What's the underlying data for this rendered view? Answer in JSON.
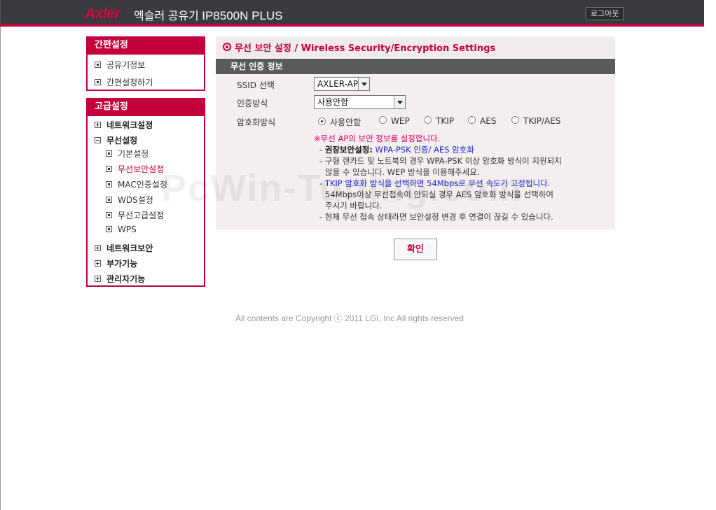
{
  "header": {
    "logo": "Axler",
    "title_ko": "엑슬러 공유기",
    "model": "IP8500N PLUS",
    "logout_label": "로그아웃"
  },
  "sidebar": {
    "simple": {
      "title": "간편설정",
      "items": [
        "공유기정보",
        "간편설정하기"
      ]
    },
    "advanced": {
      "title": "고급설정",
      "items": [
        {
          "label": "네트워크설정"
        },
        {
          "label": "무선설정"
        },
        {
          "label": "기본설정"
        },
        {
          "label": "무선보안설정"
        },
        {
          "label": "MAC인증설정"
        },
        {
          "label": "WDS설정"
        },
        {
          "label": "무선고급설정"
        },
        {
          "label": "WPS"
        },
        {
          "label": "네트워크보안"
        },
        {
          "label": "부가기능"
        },
        {
          "label": "관리자기능"
        }
      ]
    }
  },
  "main": {
    "section_title": "무선 보안 설정 / Wireless Security/Encryption Settings",
    "subsection_title": "무선 인증 정보",
    "ssid_label": "SSID 선택",
    "ssid_value": "AXLER-AP",
    "auth_label": "인증방식",
    "auth_value": "사용안함",
    "enc_label": "암호화방식",
    "enc_options": [
      "사용안함",
      "WEP",
      "TKIP",
      "AES",
      "TKIP/AES"
    ],
    "enc_selected": "사용안함",
    "info": {
      "heading": "※무선 AP의 보안 정보를 설정합니다.",
      "rec_prefix": "- ",
      "rec_label": "권장보안설정:",
      "rec_value": " WPA-PSK 인증/ AES 암호화",
      "line2a": "- 구형 랜카드 및 노트북의 경우 WPA-PSK 이상 암호화 방식이 지원되지",
      "line2b": "않을 수 있습니다. WEP 방식을 이용해주세요.",
      "line3a_prefix": "- ",
      "line3a": "TKIP 암호화 방식을 선택하면 54Mbps로 무선 속도가 고정됩니다.",
      "line3b": "54Mbps이상 무선접속이 안되실 경우 AES 암호화 방식을 선택하여",
      "line3c": "주시기 바랍니다.",
      "line4": "- 현재 무선 접속 상태라면 보안설정 변경 후 연결이 끊길 수 있습니다."
    },
    "confirm_label": "확인"
  },
  "footer": {
    "copyright": "All contents are Copyright ⓒ 2011 LGI, Inc All rights reserved"
  },
  "watermark": "PcWin-Tuning.com",
  "colors": {
    "brand": "#c4003c",
    "header_bg": "#3b3b3f",
    "subsection_bg": "#5b5b5b",
    "panel_bg": "#f4eeee",
    "info_red": "#d4006a",
    "info_blue": "#1a2ad4"
  }
}
